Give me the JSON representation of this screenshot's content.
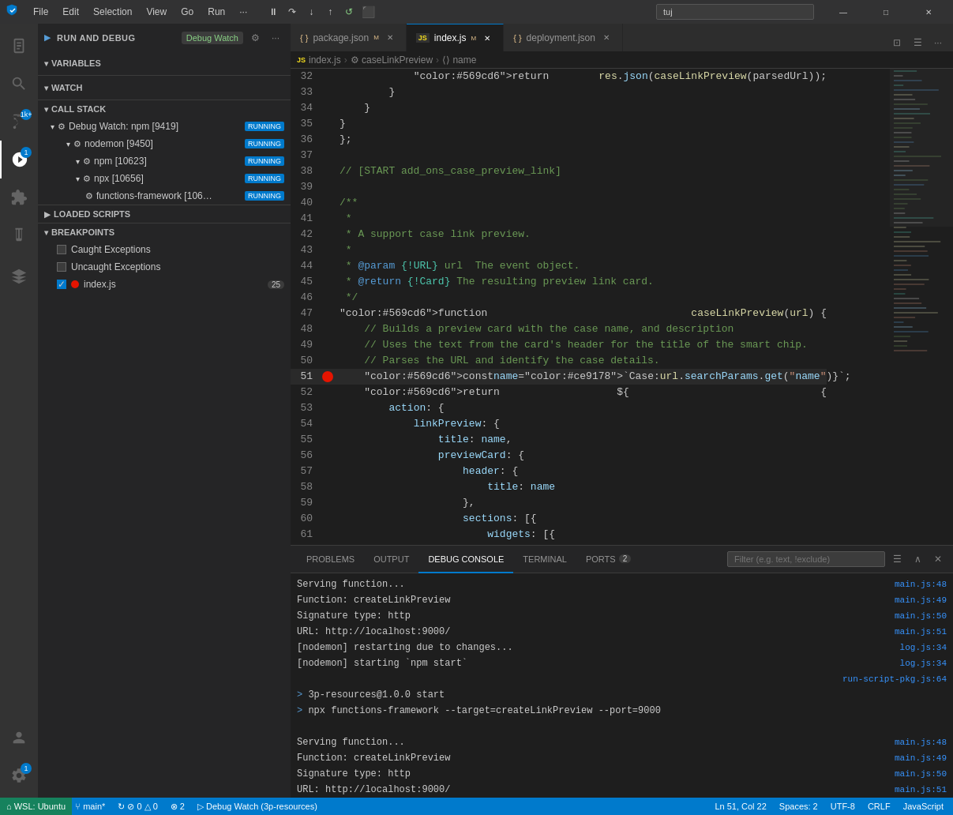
{
  "titlebar": {
    "logo": "⌨",
    "menus": [
      "File",
      "Edit",
      "Selection",
      "View",
      "Go",
      "Run",
      "···"
    ],
    "search_placeholder": "tuj",
    "window_controls": [
      "—",
      "□",
      "✕"
    ]
  },
  "activity": {
    "icons": [
      {
        "name": "explorer",
        "symbol": "⎘",
        "active": false
      },
      {
        "name": "search",
        "symbol": "🔍",
        "active": false
      },
      {
        "name": "source-control",
        "symbol": "⑂",
        "active": false,
        "badge": "1k+"
      },
      {
        "name": "run-debug",
        "symbol": "▷",
        "active": true,
        "badge": "1"
      },
      {
        "name": "extensions",
        "symbol": "⊞",
        "active": false
      },
      {
        "name": "test",
        "symbol": "⚗",
        "active": false
      },
      {
        "name": "docker",
        "symbol": "🐳",
        "active": false
      }
    ],
    "bottom_icons": [
      {
        "name": "account",
        "symbol": "👤"
      },
      {
        "name": "settings",
        "symbol": "⚙",
        "badge": "1"
      }
    ]
  },
  "sidebar": {
    "title": "RUN AND DEBUG",
    "debug_config": "Debug Watch",
    "sections": {
      "variables": {
        "label": "VARIABLES",
        "expanded": true
      },
      "watch": {
        "label": "WATCH",
        "expanded": true
      },
      "callstack": {
        "label": "CALL STACK",
        "expanded": true,
        "items": [
          {
            "label": "Debug Watch: npm [9419]",
            "level": 1,
            "status": "RUNNING",
            "icon": "gear"
          },
          {
            "label": "nodemon [9450]",
            "level": 2,
            "status": "RUNNING",
            "icon": "gear"
          },
          {
            "label": "npm [10623]",
            "level": 3,
            "status": "RUNNING",
            "icon": "gear"
          },
          {
            "label": "npx [10656]",
            "level": 3,
            "status": "RUNNING",
            "icon": "gear"
          },
          {
            "label": "functions-framework [106…",
            "level": 4,
            "status": "RUNNING",
            "icon": "gear"
          }
        ]
      },
      "loaded_scripts": {
        "label": "LOADED SCRIPTS",
        "expanded": false
      },
      "breakpoints": {
        "label": "BREAKPOINTS",
        "expanded": true,
        "items": [
          {
            "label": "Caught Exceptions",
            "checked": false
          },
          {
            "label": "Uncaught Exceptions",
            "checked": false
          },
          {
            "label": "index.js",
            "checked": true,
            "badge": "25",
            "has_dot": true
          }
        ]
      }
    }
  },
  "tabs": [
    {
      "label": "package.json",
      "icon": "{ }",
      "active": false,
      "modified": true,
      "lang": "json"
    },
    {
      "label": "index.js",
      "icon": "JS",
      "active": true,
      "modified": true,
      "lang": "js"
    },
    {
      "label": "deployment.json",
      "icon": "{ }",
      "active": false,
      "modified": false,
      "lang": "json"
    }
  ],
  "breadcrumb": {
    "items": [
      "JS index.js",
      "⚙ caseLinkPreview",
      "⟨⟩ name"
    ]
  },
  "code": {
    "lines": [
      {
        "num": 32,
        "content": "            return res.json(caseLinkPreview(parsedUrl));",
        "bp": false,
        "current": false
      },
      {
        "num": 33,
        "content": "        }",
        "bp": false,
        "current": false
      },
      {
        "num": 34,
        "content": "    }",
        "bp": false,
        "current": false
      },
      {
        "num": 35,
        "content": "}",
        "bp": false,
        "current": false
      },
      {
        "num": 36,
        "content": "};",
        "bp": false,
        "current": false
      },
      {
        "num": 37,
        "content": "",
        "bp": false,
        "current": false
      },
      {
        "num": 38,
        "content": "// [START add_ons_case_preview_link]",
        "bp": false,
        "current": false
      },
      {
        "num": 39,
        "content": "",
        "bp": false,
        "current": false
      },
      {
        "num": 40,
        "content": "/**",
        "bp": false,
        "current": false
      },
      {
        "num": 41,
        "content": " *",
        "bp": false,
        "current": false
      },
      {
        "num": 42,
        "content": " * A support case link preview.",
        "bp": false,
        "current": false
      },
      {
        "num": 43,
        "content": " *",
        "bp": false,
        "current": false
      },
      {
        "num": 44,
        "content": " * @param {!URL} url  The event object.",
        "bp": false,
        "current": false
      },
      {
        "num": 45,
        "content": " * @return {!Card} The resulting preview link card.",
        "bp": false,
        "current": false
      },
      {
        "num": 46,
        "content": " */",
        "bp": false,
        "current": false
      },
      {
        "num": 47,
        "content": "function caseLinkPreview(url) {",
        "bp": false,
        "current": false
      },
      {
        "num": 48,
        "content": "    // Builds a preview card with the case name, and description",
        "bp": false,
        "current": false
      },
      {
        "num": 49,
        "content": "    // Uses the text from the card's header for the title of the smart chip.",
        "bp": false,
        "current": false
      },
      {
        "num": 50,
        "content": "    // Parses the URL and identify the case details.",
        "bp": false,
        "current": false
      },
      {
        "num": 51,
        "content": "    const name = `Case: ${url.searchParams.get(\"name\")}`;",
        "bp": true,
        "current": true
      },
      {
        "num": 52,
        "content": "    return {",
        "bp": false,
        "current": false
      },
      {
        "num": 53,
        "content": "        action: {",
        "bp": false,
        "current": false
      },
      {
        "num": 54,
        "content": "            linkPreview: {",
        "bp": false,
        "current": false
      },
      {
        "num": 55,
        "content": "                title: name,",
        "bp": false,
        "current": false
      },
      {
        "num": 56,
        "content": "                previewCard: {",
        "bp": false,
        "current": false
      },
      {
        "num": 57,
        "content": "                    header: {",
        "bp": false,
        "current": false
      },
      {
        "num": 58,
        "content": "                        title: name",
        "bp": false,
        "current": false
      },
      {
        "num": 59,
        "content": "                    },",
        "bp": false,
        "current": false
      },
      {
        "num": 60,
        "content": "                    sections: [{",
        "bp": false,
        "current": false
      },
      {
        "num": 61,
        "content": "                        widgets: [{",
        "bp": false,
        "current": false
      }
    ]
  },
  "bottom_panel": {
    "tabs": [
      {
        "label": "PROBLEMS",
        "active": false
      },
      {
        "label": "OUTPUT",
        "active": false
      },
      {
        "label": "DEBUG CONSOLE",
        "active": true
      },
      {
        "label": "TERMINAL",
        "active": false
      },
      {
        "label": "PORTS",
        "active": false,
        "badge": "2"
      }
    ],
    "filter_placeholder": "Filter (e.g. text, !exclude)",
    "console_lines": [
      {
        "text": "Serving function...",
        "link": "main.js:48"
      },
      {
        "text": "Function: createLinkPreview",
        "link": "main.js:49"
      },
      {
        "text": "Signature type: http",
        "link": "main.js:50"
      },
      {
        "text": "URL: http://localhost:9000/",
        "link": "main.js:51"
      },
      {
        "text": "[nodemon] restarting due to changes...",
        "link": "log.js:34"
      },
      {
        "text": "[nodemon] starting `npm start`",
        "link": "log.js:34"
      },
      {
        "text": "",
        "link": "run-script-pkg.js:64"
      },
      {
        "text": "> 3p-resources@1.0.0 start",
        "link": "",
        "is_cmd": true
      },
      {
        "text": "> npx functions-framework --target=createLinkPreview --port=9000",
        "link": "",
        "is_cmd": true
      },
      {
        "text": "",
        "link": ""
      },
      {
        "text": "Serving function...",
        "link": "main.js:48"
      },
      {
        "text": "Function: createLinkPreview",
        "link": "main.js:49"
      },
      {
        "text": "Signature type: http",
        "link": "main.js:50"
      },
      {
        "text": "URL: http://localhost:9000/",
        "link": "main.js:51"
      }
    ],
    "prompt_symbol": ">",
    "prompt_placeholder": ""
  },
  "statusbar": {
    "remote": "⌂ WSL: Ubuntu",
    "branch": "⑂ main*",
    "sync": "↻ ⊘ 0 △ 0",
    "errors": "⊗ 2",
    "position": "Ln 51, Col 22",
    "spaces": "Spaces: 2",
    "encoding": "UTF-8",
    "eol": "CRLF",
    "language": "JavaScript",
    "debug": "▷ Debug Watch (3p-resources)"
  }
}
